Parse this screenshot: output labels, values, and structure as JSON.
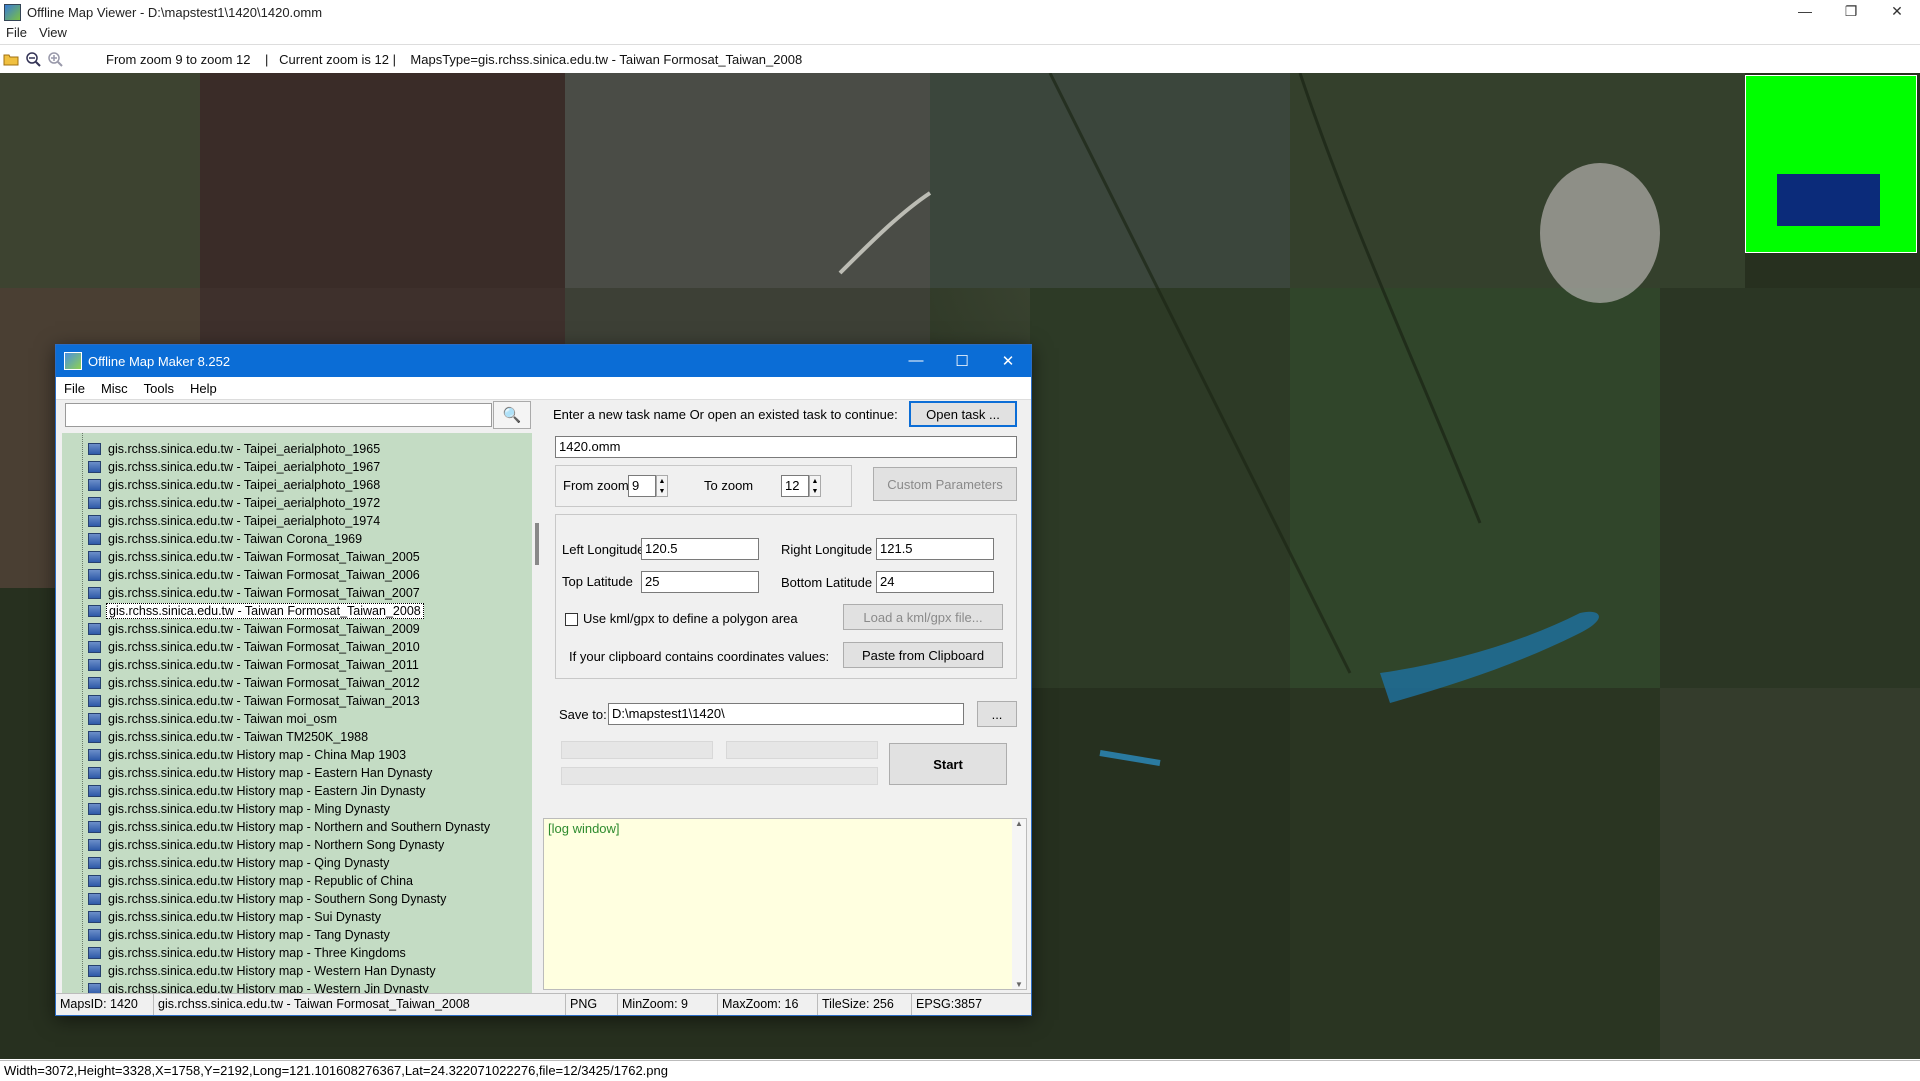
{
  "window": {
    "title": "Offline Map Viewer - D:\\mapstest1\\1420\\1420.omm",
    "controls": [
      "—",
      "❐",
      "✕"
    ]
  },
  "menu": [
    "File",
    "View"
  ],
  "toolbar": {
    "info": "From zoom 9 to zoom 12    |   Current zoom is 12 |    MapsType=gis.rchss.sinica.edu.tw - Taiwan Formosat_Taiwan_2008"
  },
  "colors": {
    "overview_bg": "#00ff00",
    "overview_viewport": "#0b2b7a",
    "tree_bg": "#c4dcc4",
    "log_bg": "#ffffe0",
    "dialog_title": "#0b6dd6"
  },
  "status": "Width=3072,Height=3328,X=1758,Y=2192,Long=121.101608276367,Lat=24.322071022276,file=12/3425/1762.png",
  "dialog": {
    "title": "Offline Map Maker 8.252",
    "controls": [
      "—",
      "☐",
      "✕"
    ],
    "menu": [
      "File",
      "Misc",
      "Tools",
      "Help"
    ],
    "search_value": "",
    "search_icon": "🔍",
    "tree_items": [
      "gis.rchss.sinica.edu.tw - Taipei_aerialphoto_1965",
      "gis.rchss.sinica.edu.tw - Taipei_aerialphoto_1967",
      "gis.rchss.sinica.edu.tw - Taipei_aerialphoto_1968",
      "gis.rchss.sinica.edu.tw - Taipei_aerialphoto_1972",
      "gis.rchss.sinica.edu.tw - Taipei_aerialphoto_1974",
      "gis.rchss.sinica.edu.tw - Taiwan Corona_1969",
      "gis.rchss.sinica.edu.tw - Taiwan Formosat_Taiwan_2005",
      "gis.rchss.sinica.edu.tw - Taiwan Formosat_Taiwan_2006",
      "gis.rchss.sinica.edu.tw - Taiwan Formosat_Taiwan_2007",
      "gis.rchss.sinica.edu.tw - Taiwan Formosat_Taiwan_2008",
      "gis.rchss.sinica.edu.tw - Taiwan Formosat_Taiwan_2009",
      "gis.rchss.sinica.edu.tw - Taiwan Formosat_Taiwan_2010",
      "gis.rchss.sinica.edu.tw - Taiwan Formosat_Taiwan_2011",
      "gis.rchss.sinica.edu.tw - Taiwan Formosat_Taiwan_2012",
      "gis.rchss.sinica.edu.tw - Taiwan Formosat_Taiwan_2013",
      "gis.rchss.sinica.edu.tw - Taiwan moi_osm",
      "gis.rchss.sinica.edu.tw - Taiwan TM250K_1988",
      "gis.rchss.sinica.edu.tw History map - China Map 1903",
      "gis.rchss.sinica.edu.tw History map - Eastern Han Dynasty",
      "gis.rchss.sinica.edu.tw History map - Eastern Jin Dynasty",
      "gis.rchss.sinica.edu.tw History map - Ming Dynasty",
      "gis.rchss.sinica.edu.tw History map - Northern and Southern Dynasty",
      "gis.rchss.sinica.edu.tw History map - Northern Song Dynasty",
      "gis.rchss.sinica.edu.tw History map - Qing Dynasty",
      "gis.rchss.sinica.edu.tw History map - Republic of China",
      "gis.rchss.sinica.edu.tw History map - Southern Song Dynasty",
      "gis.rchss.sinica.edu.tw History map - Sui Dynasty",
      "gis.rchss.sinica.edu.tw History map - Tang Dynasty",
      "gis.rchss.sinica.edu.tw History map - Three Kingdoms",
      "gis.rchss.sinica.edu.tw History map - Western Han Dynasty",
      "gis.rchss.sinica.edu.tw History map - Western Jin Dynasty"
    ],
    "selected_item": "gis.rchss.sinica.edu.tw - Taiwan Formosat_Taiwan_2008",
    "task_label": "Enter a new task name Or open an existed task to continue:",
    "open_task": "Open task ...",
    "task_name": "1420.omm",
    "from_zoom_label": "From zoom",
    "from_zoom": "9",
    "to_zoom_label": "To zoom",
    "to_zoom": "12",
    "custom_params": "Custom Parameters",
    "left_lon_label": "Left Longitude",
    "left_lon": "120.5",
    "right_lon_label": "Right Longitude",
    "right_lon": "121.5",
    "top_lat_label": "Top Latitude",
    "top_lat": "25",
    "bottom_lat_label": "Bottom Latitude",
    "bottom_lat": "24",
    "kml_check_label": "Use kml/gpx to define a polygon area",
    "kml_checked": false,
    "load_kml": "Load a kml/gpx file...",
    "clipboard_label": "If your clipboard contains coordinates values:",
    "paste_clipboard": "Paste from Clipboard",
    "save_label": "Save to:",
    "save_path": "D:\\mapstest1\\1420\\",
    "browse": "...",
    "start": "Start",
    "log_text": "[log window]",
    "statusbar": {
      "maps_id": "MapsID: 1420",
      "maps_name": "gis.rchss.sinica.edu.tw - Taiwan Formosat_Taiwan_2008",
      "format": "PNG",
      "min_zoom": "MinZoom: 9",
      "max_zoom": "MaxZoom: 16",
      "tile_size": "TileSize: 256",
      "epsg": "EPSG:3857"
    }
  }
}
